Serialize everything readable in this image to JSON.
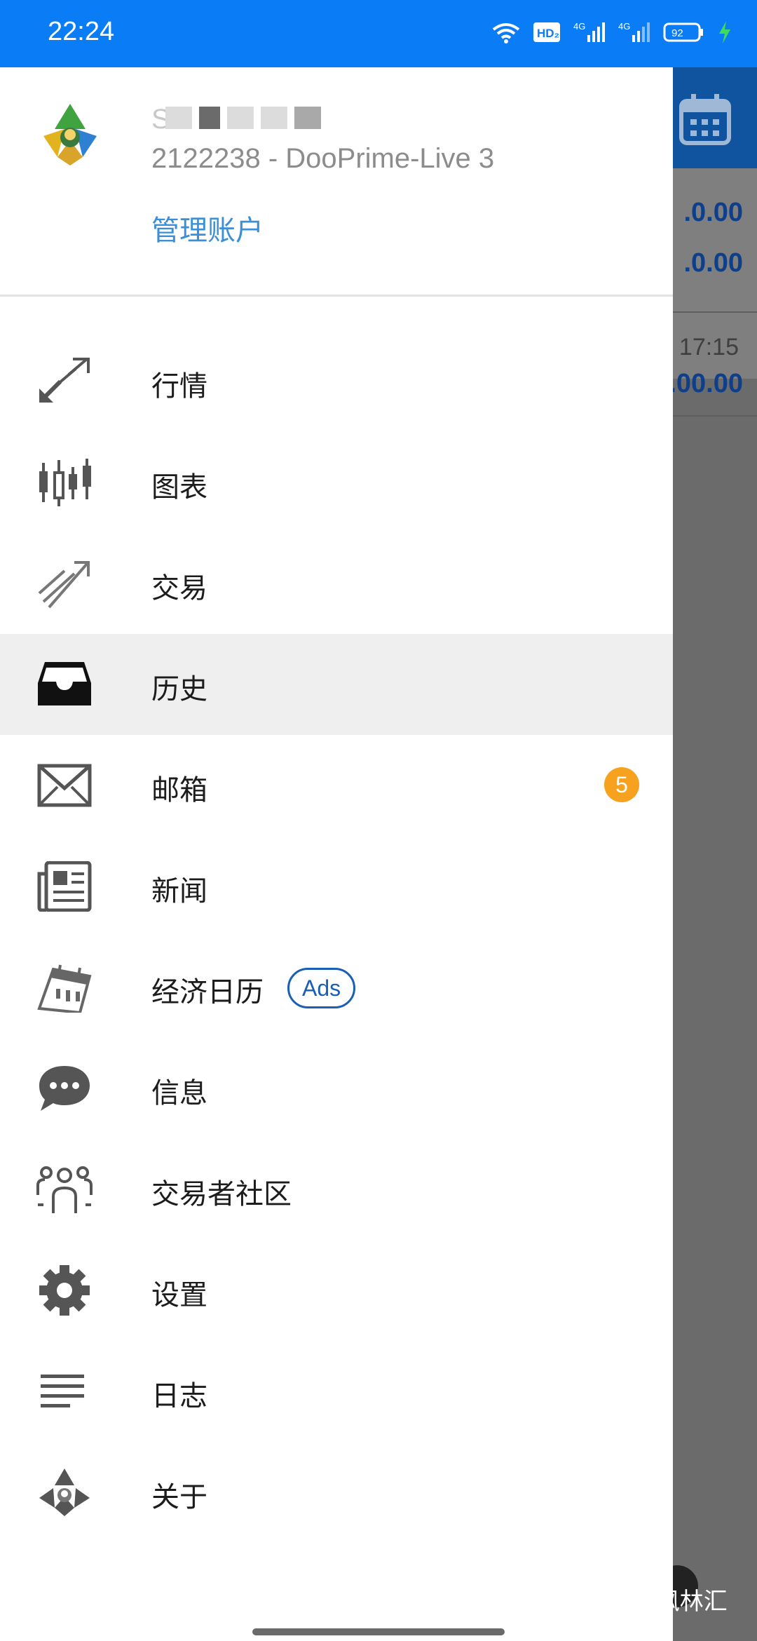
{
  "status_bar": {
    "time": "22:24",
    "network_badge": "HD₂",
    "signal1": "4G",
    "signal2": "4G",
    "battery": "92"
  },
  "background_app": {
    "values": [
      ".0.00",
      ".0.00",
      ".00.00"
    ],
    "time": "17:15"
  },
  "drawer": {
    "account": {
      "name": "S",
      "id": "2122238 - DooPrime-Live 3",
      "manage_label": "管理账户"
    },
    "menu": [
      {
        "label": "行情",
        "icon": "quotes-icon"
      },
      {
        "label": "图表",
        "icon": "candlestick-chart-icon"
      },
      {
        "label": "交易",
        "icon": "trade-icon"
      },
      {
        "label": "历史",
        "icon": "history-inbox-icon",
        "active": true
      },
      {
        "label": "邮箱",
        "icon": "mail-icon",
        "badge": "5"
      },
      {
        "label": "新闻",
        "icon": "news-icon"
      },
      {
        "label": "经济日历",
        "icon": "calendar-icon",
        "tag": "Ads"
      },
      {
        "label": "信息",
        "icon": "chat-bubble-icon"
      },
      {
        "label": "交易者社区",
        "icon": "community-icon"
      },
      {
        "label": "设置",
        "icon": "gear-icon"
      },
      {
        "label": "日志",
        "icon": "journal-lines-icon"
      },
      {
        "label": "关于",
        "icon": "about-logo-icon"
      }
    ]
  },
  "watermark": "♪@枫林汇",
  "colors": {
    "status_bar": "#0a7cf6",
    "link": "#3b8fd6",
    "badge": "#f6a21e",
    "ads": "#1a5fb4",
    "app_header": "#10539e"
  }
}
